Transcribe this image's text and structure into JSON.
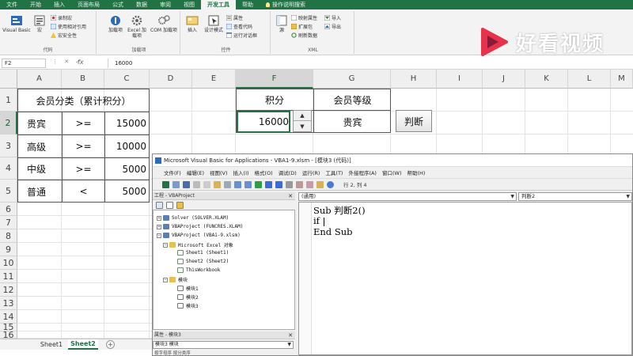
{
  "ribbon": {
    "tabs": [
      "文件",
      "开始",
      "插入",
      "页面布局",
      "公式",
      "数据",
      "审阅",
      "视图",
      "开发工具",
      "帮助",
      "操作说明搜索"
    ],
    "active_tab": "开发工具",
    "groups": {
      "code": {
        "name": "代码",
        "visual_basic": "Visual Basic",
        "macros": "宏",
        "record_macro": "录制宏",
        "relative_ref": "使用相对引用",
        "macro_security": "宏安全性"
      },
      "addins": {
        "name": "加载项",
        "addins": "加载项",
        "excel_addins": "Excel 加载项",
        "com_addins": "COM 加载项"
      },
      "controls": {
        "name": "控件",
        "insert": "插入",
        "design_mode": "设计模式",
        "properties": "属性",
        "view_code": "查看代码",
        "run_dialog": "运行对话框"
      },
      "xml": {
        "name": "XML",
        "source": "源",
        "map_props": "映射属性",
        "expansion_pack": "扩展包",
        "refresh_data": "刷新数据",
        "import": "导入",
        "export": "导出"
      }
    }
  },
  "formula_bar": {
    "name_box": "F2",
    "fx": "fx",
    "value": "16000"
  },
  "columns": [
    "A",
    "B",
    "C",
    "D",
    "E",
    "F",
    "G",
    "H",
    "I",
    "J",
    "K",
    "L",
    "M"
  ],
  "rows": [
    "1",
    "2",
    "3",
    "4",
    "5",
    "6",
    "7",
    "8",
    "9",
    "10",
    "11",
    "12",
    "13",
    "14",
    "15",
    "16"
  ],
  "table": {
    "title": "会员分类（累计积分）",
    "rows": [
      {
        "level": "贵宾",
        "op": ">=",
        "points": "15000"
      },
      {
        "level": "高级",
        "op": ">=",
        "points": "10000"
      },
      {
        "level": "中级",
        "op": ">=",
        "points": "5000"
      },
      {
        "level": "普通",
        "op": "<",
        "points": "5000"
      }
    ]
  },
  "lookup": {
    "points_header": "积分",
    "level_header": "会员等级",
    "points_value": "16000",
    "level_value": "贵宾",
    "judge_button": "判断"
  },
  "sheets": [
    "Sheet1",
    "Sheet2"
  ],
  "active_sheet": "Sheet2",
  "vba": {
    "title": "Microsoft Visual Basic for Applications - VBA1-9.xlsm - [模块3 (代码)]",
    "menu": [
      "文件(F)",
      "编辑(E)",
      "视图(V)",
      "插入(I)",
      "格式(O)",
      "调试(D)",
      "运行(R)",
      "工具(T)",
      "外接程序(A)",
      "窗口(W)",
      "帮助(H)"
    ],
    "cursor_pos": "行 2, 列 4",
    "project_title": "工程 - VBAProject",
    "tree": [
      "Solver (SOLVER.XLAM)",
      "VBAProject (FUNCRES.XLAM)",
      "VBAProject (VBA1-9.xlsm)",
      "Microsoft Excel 对象",
      "Sheet1 (Sheet1)",
      "Sheet2 (Sheet2)",
      "ThisWorkbook",
      "模块",
      "模块1",
      "模块2",
      "模块3"
    ],
    "props_title": "属性 - 模块3",
    "props_selector": "模块3 模块",
    "props_tabs": "按字母序  按分类序",
    "object_box": "(通用)",
    "proc_box": "判断2",
    "code_lines": [
      "Sub 判断2()",
      "if ",
      "End Sub"
    ]
  },
  "watermark": "好看视频",
  "colors": {
    "excel_green": "#217346",
    "watermark_red": "#e6324b"
  }
}
